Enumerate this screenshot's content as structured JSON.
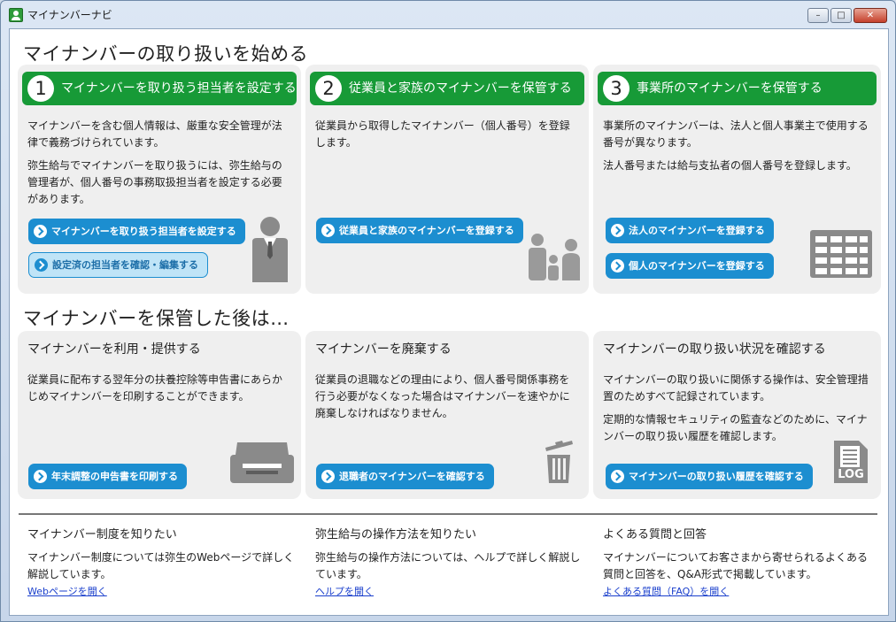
{
  "window": {
    "title": "マイナンバーナビ",
    "min_glyph": "–",
    "max_glyph": "□",
    "close_glyph": "✕"
  },
  "section1": {
    "title": "マイナンバーの取り扱いを始める",
    "steps": [
      {
        "num": "1",
        "heading": "マイナンバーを取り扱う担当者を設定する",
        "para1": "マイナンバーを含む個人情報は、厳重な安全管理が法律で義務づけられています。",
        "para2": "弥生給与でマイナンバーを取り扱うには、弥生給与の管理者が、個人番号の事務取扱担当者を設定する必要があります。",
        "button1": "マイナンバーを取り扱う担当者を設定する",
        "button2": "設定済の担当者を確認・編集する",
        "icon": "person-icon"
      },
      {
        "num": "2",
        "heading": "従業員と家族のマイナンバーを保管する",
        "para1": "従業員から取得したマイナンバー（個人番号）を登録します。",
        "button1": "従業員と家族のマイナンバーを登録する",
        "icon": "family-icon"
      },
      {
        "num": "3",
        "heading": "事業所のマイナンバーを保管する",
        "para1": "事業所のマイナンバーは、法人と個人事業主で使用する番号が異なります。",
        "para2": "法人番号または給与支払者の個人番号を登録します。",
        "button1": "法人のマイナンバーを登録する",
        "button2": "個人のマイナンバーを登録する",
        "icon": "building-icon"
      }
    ]
  },
  "section2": {
    "title": "マイナンバーを保管した後は…",
    "panels": [
      {
        "heading": "マイナンバーを利用・提供する",
        "para1": "従業員に配布する翌年分の扶養控除等申告書にあらかじめマイナンバーを印刷することができます。",
        "button": "年末調整の申告書を印刷する",
        "icon": "printer-icon"
      },
      {
        "heading": "マイナンバーを廃棄する",
        "para1": "従業員の退職などの理由により、個人番号関係事務を行う必要がなくなった場合はマイナンバーを速やかに廃棄しなければなりません。",
        "button": "退職者のマイナンバーを確認する",
        "icon": "trash-icon"
      },
      {
        "heading": "マイナンバーの取り扱い状況を確認する",
        "para1": "マイナンバーの取り扱いに関係する操作は、安全管理措置のためすべて記録されています。",
        "para2": "定期的な情報セキュリティの監査などのために、マイナンバーの取り扱い履歴を確認します。",
        "button": "マイナンバーの取り扱い履歴を確認する",
        "icon": "log-icon",
        "icon_label": "LOG"
      }
    ]
  },
  "footer": [
    {
      "title": "マイナンバー制度を知りたい",
      "desc": "マイナンバー制度については弥生のWebページで詳しく解説しています。",
      "link": "Webページを開く"
    },
    {
      "title": "弥生給与の操作方法を知りたい",
      "desc": "弥生給与の操作方法については、ヘルプで詳しく解説しています。",
      "link": "ヘルプを開く"
    },
    {
      "title": "よくある質問と回答",
      "desc": "マイナンバーについてお客さまから寄せられるよくある質問と回答を、Q&A形式で掲載しています。",
      "link": "よくある質問（FAQ）を開く"
    }
  ]
}
